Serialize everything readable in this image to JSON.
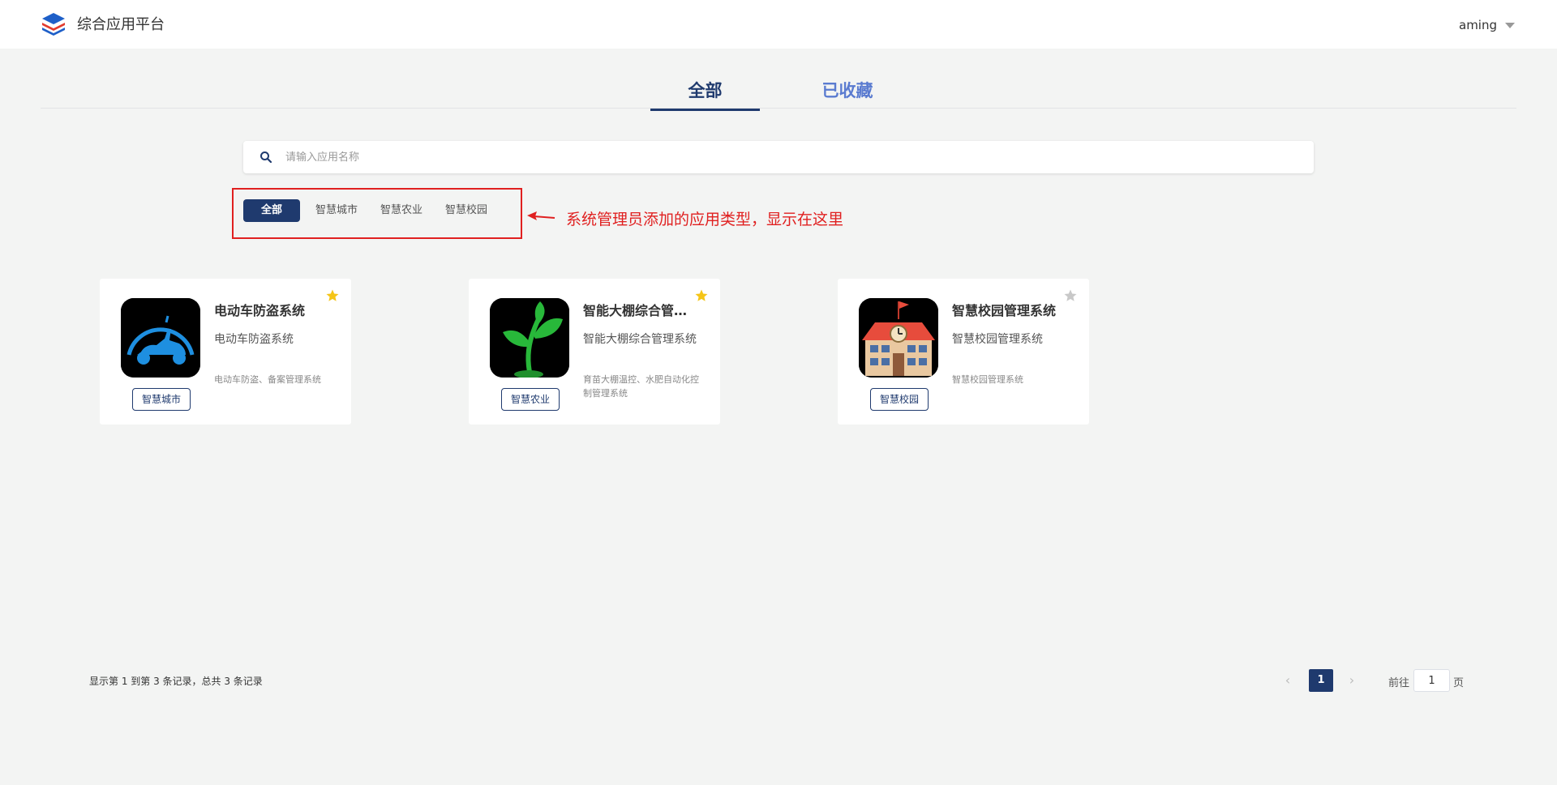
{
  "header": {
    "brand": "综合应用平台",
    "user": "aming"
  },
  "tabs": [
    {
      "label": "全部",
      "active": true
    },
    {
      "label": "已收藏",
      "active": false
    }
  ],
  "search": {
    "placeholder": "请输入应用名称",
    "value": ""
  },
  "categories": [
    {
      "label": "全部",
      "active": true
    },
    {
      "label": "智慧城市",
      "active": false
    },
    {
      "label": "智慧农业",
      "active": false
    },
    {
      "label": "智慧校园",
      "active": false
    }
  ],
  "annotation": {
    "text": "系统管理员添加的应用类型，显示在这里",
    "color": "#e02020"
  },
  "apps": [
    {
      "title": "电动车防盗系统",
      "subtitle": "电动车防盗系统",
      "description": "电动车防盗、备案管理系统",
      "tag": "智慧城市",
      "favorited": true,
      "icon": "electric-scooter-icon"
    },
    {
      "title": "智能大棚综合管理系统",
      "subtitle": "智能大棚综合管理系统",
      "description": "育苗大棚温控、水肥自动化控制管理系统",
      "tag": "智慧农业",
      "favorited": true,
      "icon": "plant-sprout-icon"
    },
    {
      "title": "智慧校园管理系统",
      "subtitle": "智慧校园管理系统",
      "description": "智慧校园管理系统",
      "tag": "智慧校园",
      "favorited": false,
      "icon": "school-building-icon"
    }
  ],
  "pagination": {
    "summary": "显示第 1 到第 3 条记录，总共 3 条记录",
    "current_page": "1",
    "goto_label": "前往",
    "goto_value": "1",
    "goto_suffix": "页"
  },
  "colors": {
    "primary": "#1f3a6e",
    "tab_inactive": "#5a7bd0",
    "background": "#f3f4f3",
    "star_active": "#f5c518",
    "star_inactive": "#c8c8c8"
  }
}
